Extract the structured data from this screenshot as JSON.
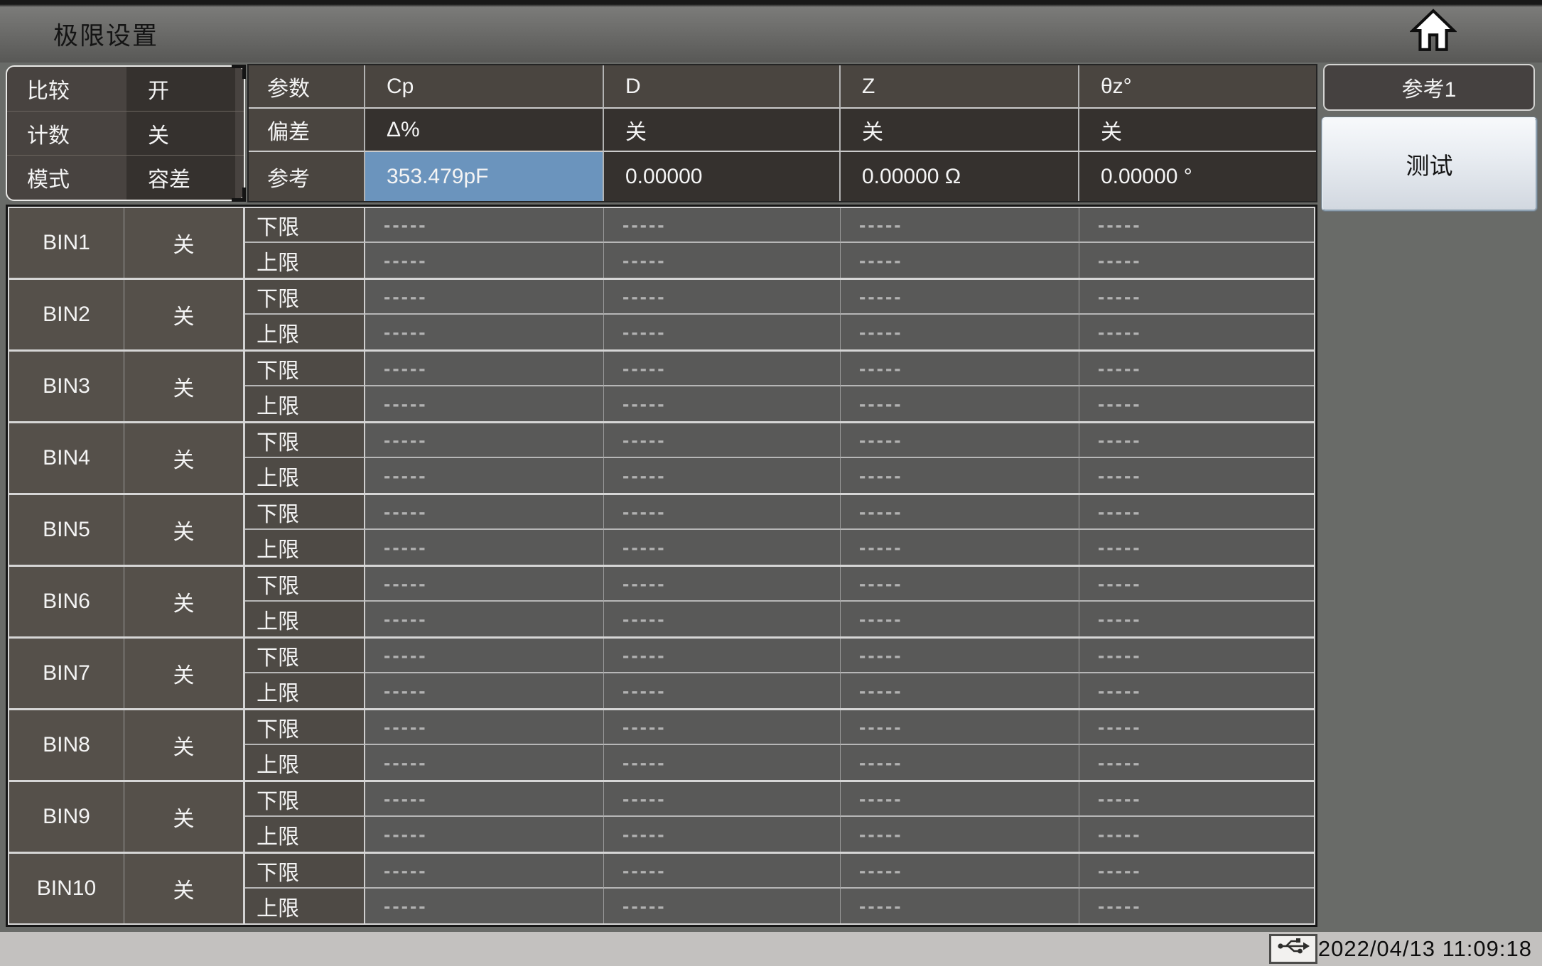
{
  "title_bar": {
    "title": "极限设置"
  },
  "comparator_panel": {
    "rows": [
      {
        "label": "比较",
        "value": "开"
      },
      {
        "label": "计数",
        "value": "关"
      },
      {
        "label": "模式",
        "value": "容差"
      }
    ]
  },
  "param_table": {
    "row_labels": {
      "param": "参数",
      "deviation": "偏差",
      "reference": "参考"
    },
    "columns": [
      {
        "param": "Cp",
        "deviation": "Δ%",
        "reference": "353.479pF",
        "highlighted": true
      },
      {
        "param": "D",
        "deviation": "关",
        "reference": "0.00000",
        "highlighted": false
      },
      {
        "param": "Z",
        "deviation": "关",
        "reference": "0.00000 Ω",
        "highlighted": false
      },
      {
        "param": "θz°",
        "deviation": "关",
        "reference": "0.00000 °",
        "highlighted": false
      }
    ]
  },
  "bin_table": {
    "lower_label": "下限",
    "upper_label": "上限",
    "empty_value": "-----",
    "value_columns": 4,
    "bins": [
      {
        "name": "BIN1",
        "state": "关"
      },
      {
        "name": "BIN2",
        "state": "关"
      },
      {
        "name": "BIN3",
        "state": "关"
      },
      {
        "name": "BIN4",
        "state": "关"
      },
      {
        "name": "BIN5",
        "state": "关"
      },
      {
        "name": "BIN6",
        "state": "关"
      },
      {
        "name": "BIN7",
        "state": "关"
      },
      {
        "name": "BIN8",
        "state": "关"
      },
      {
        "name": "BIN9",
        "state": "关"
      },
      {
        "name": "BIN10",
        "state": "关"
      }
    ]
  },
  "sidebar": {
    "reference_tab": "参考1",
    "test_button": "测试"
  },
  "status_bar": {
    "datetime": "2022/04/13 11:09:18"
  },
  "colors": {
    "reference_highlight": "#6b94bd",
    "background": "#696b68"
  }
}
